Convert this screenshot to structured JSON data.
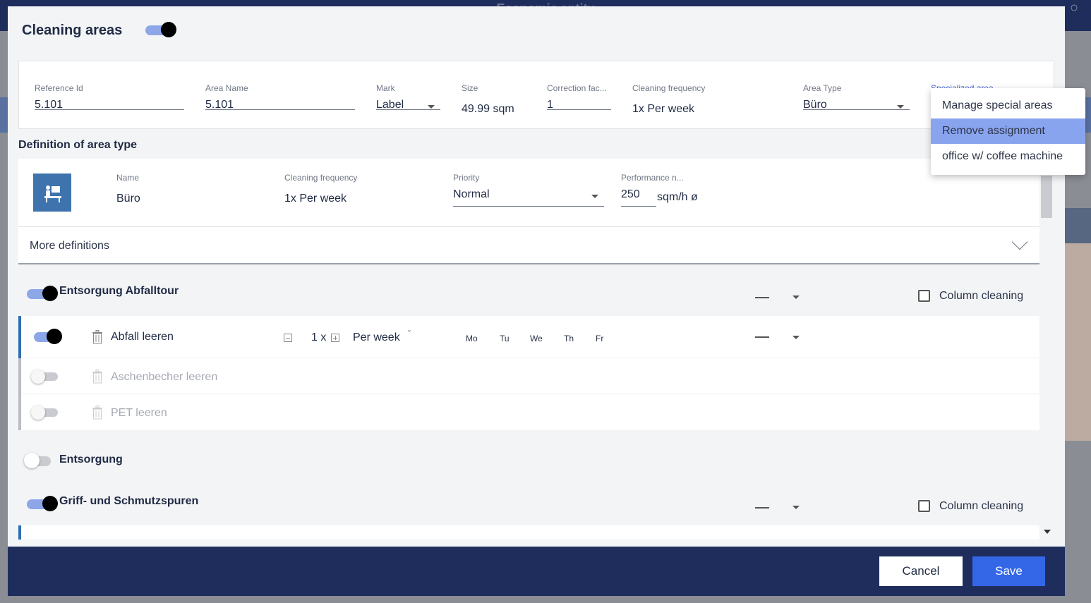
{
  "background": {
    "title": "Economic entity"
  },
  "modal": {
    "title": "Cleaning areas",
    "reference": {
      "ref_id": {
        "label": "Reference Id",
        "value": "5.101"
      },
      "area_name": {
        "label": "Area Name",
        "value": "5.101"
      },
      "mark": {
        "label": "Mark",
        "value": "Label"
      },
      "size": {
        "label": "Size",
        "value": "49.99 sqm"
      },
      "correction": {
        "label": "Correction fac...",
        "value": "1"
      },
      "cleaning_frequency": {
        "label": "Cleaning frequency",
        "value": "1x Per week"
      },
      "area_type": {
        "label": "Area Type",
        "value": "Büro"
      },
      "specialized": {
        "label": "Specialized area"
      }
    },
    "definition": {
      "title": "Definition of area type",
      "name": {
        "label": "Name",
        "value": "Büro"
      },
      "cleaning_frequency": {
        "label": "Cleaning frequency",
        "value": "1x Per week"
      },
      "priority": {
        "label": "Priority",
        "value": "Normal"
      },
      "performance": {
        "label": "Performance n...",
        "value": "250",
        "unit": "sqm/h ø"
      },
      "more": "More definitions"
    },
    "groups": [
      {
        "title": "Entsorgung Abfalltour",
        "column_cleaning": "Column cleaning"
      },
      {
        "title": "Entsorgung"
      },
      {
        "title": "Griff- und Schmutzspuren",
        "column_cleaning": "Column cleaning"
      }
    ],
    "tasks": [
      {
        "name": "Abfall leeren",
        "count": "1 x",
        "period": "Per week",
        "days": [
          "Mo",
          "Tu",
          "We",
          "Th",
          "Fr"
        ]
      },
      {
        "name": "Aschenbecher leeren"
      },
      {
        "name": "PET leeren"
      }
    ]
  },
  "dropdown": {
    "items": [
      "Manage special areas",
      "Remove assignment",
      "office w/ coffee machine"
    ],
    "selected": "Remove assignment"
  },
  "footer": {
    "cancel": "Cancel",
    "save": "Save"
  },
  "colors": {
    "navy": "#1e2d5c",
    "primary": "#3467e8",
    "highlight": "#89a4ee",
    "toggle_on": "#8da6e8"
  }
}
